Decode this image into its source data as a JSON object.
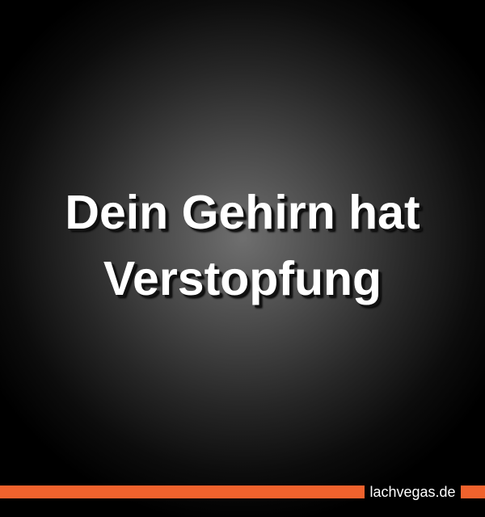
{
  "headline": {
    "line1": "Dein Gehirn hat",
    "line2": "Verstopfung"
  },
  "footer": {
    "brand": "lachvegas.de"
  },
  "colors": {
    "accent": "#f0622d",
    "text": "#ffffff",
    "background": "#000000"
  }
}
